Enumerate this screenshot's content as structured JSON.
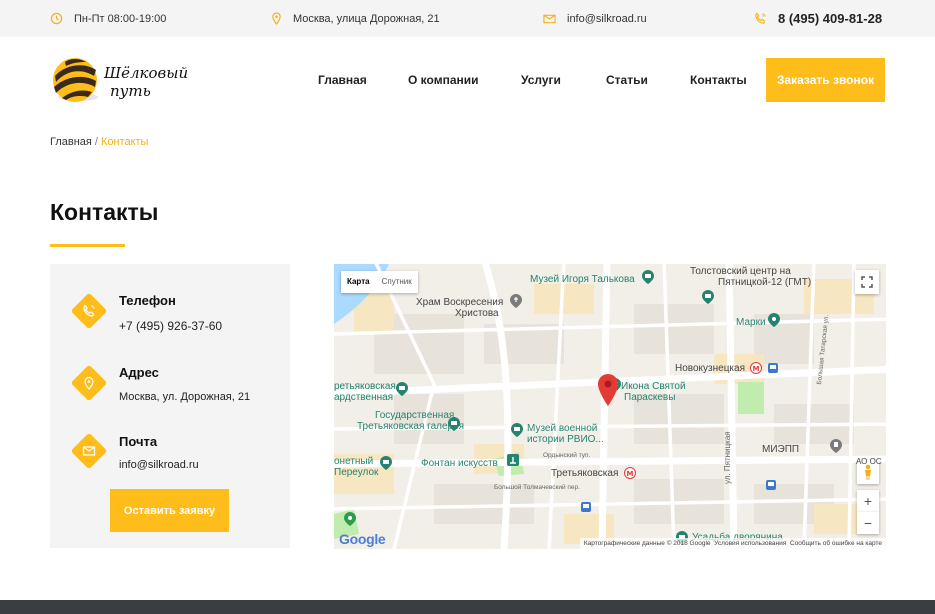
{
  "topbar": {
    "hours": "Пн-Пт 08:00-19:00",
    "address": "Москва, улица Дорожная, 21",
    "email": "info@silkroad.ru",
    "phone": "8 (495) 409-81-28"
  },
  "logo": {
    "text_line1": "Шёлковый",
    "text_line2": "путь"
  },
  "nav": {
    "items": [
      "Главная",
      "О компании",
      "Услуги",
      "Статьи",
      "Контакты"
    ],
    "cta_label": "Заказать звонок"
  },
  "breadcrumb": {
    "home": "Главная",
    "separator": "/",
    "current": "Контакты"
  },
  "page_title": "Контакты",
  "contacts": {
    "phone_label": "Телефон",
    "phone_value": "+7 (495) 926-37-60",
    "address_label": "Адрес",
    "address_value": "Москва, ул. Дорожная, 21",
    "email_label": "Почта",
    "email_value": "info@silkroad.ru",
    "button_label": "Оставить заявку"
  },
  "map": {
    "type_map": "Карта",
    "type_sat": "Спутник",
    "pois": {
      "talkov": "Музей Игоря Талькова",
      "tolstovsky1": "Толстовский центр на",
      "tolstovsky2": "Пятницкой-12 (ГМТ)",
      "khram1": "Храм Воскресения",
      "khram2": "Христова",
      "marki": "Марки",
      "novokuz": "Новокузнецкая",
      "ikona1": "Икона Святой",
      "ikona2": "Параскевы",
      "tretyak1": "ретьяковская",
      "tretyak2": "ардственная",
      "gal1": "Государственная",
      "gal2": "Третьяковская галерея",
      "muzvoen1": "Музей военной",
      "muzvoen2": "истории РВИО...",
      "mieppp": "МИЭПП",
      "fontan": "Фонтан искусств",
      "pereulok1": "онетный",
      "pereulok2": "Переулок",
      "tretmetro": "Третьяковская",
      "ordynsky": "Ордынский туп.",
      "tolmach": "Большой Толмачевский пер.",
      "usadba": "Усадьба дворянина",
      "pyatnitskaya": "ул. Пятницкая",
      "bolshaya_tatarskaya": "Большая Татарская ул.",
      "aooc": "АО ОС"
    },
    "attribution": "Картографические данные © 2018 Google",
    "terms": "Условия использования",
    "report": "Сообщить об ошибке на карте",
    "google": "Google",
    "zoom_in": "+",
    "zoom_out": "−"
  },
  "colors": {
    "accent": "#ffbd1b",
    "poi_teal": "#25836f",
    "marker_red": "#e53935"
  }
}
